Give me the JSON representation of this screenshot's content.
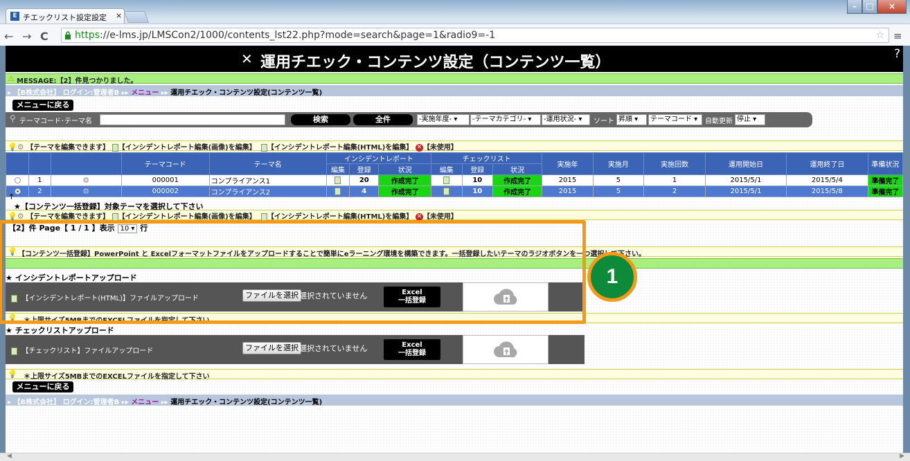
{
  "browser": {
    "tab_title": "チエックリスト設定設定",
    "tab_close": "×",
    "favicon_letter": "E",
    "url_scheme": "https",
    "url_rest": "://e-lms.jp/LMSCon2/1000/contents_lst22.php?mode=search&page=1&radio9=-1"
  },
  "page": {
    "title": "運用チエック・コンテンツ設定（コンテンツ一覧）",
    "message": "MESSAGE:【2】件見つかりました。",
    "breadcrumb_company": "【B株式会社】",
    "breadcrumb_login": "ログイン:管理者B",
    "breadcrumb_menu": "メニュー",
    "breadcrumb_current": "運用チエック・コンテンツ設定(コンテンツ一覧)",
    "back_menu": "メニューに戻る"
  },
  "search": {
    "label": "テーマコード･テーマ名",
    "search_btn": "検索",
    "all_btn": "全件",
    "year_select": "-実施年度-",
    "category_select": "-テーマカテゴリ-",
    "status_select": "-運用状況-",
    "sort_label": "ソート",
    "order_select": "昇順",
    "sortkey_select": "テーマコード",
    "auto_update_label": "自動更新",
    "auto_update_select": "停止"
  },
  "legend": {
    "editable": "【テーマを編集できます】",
    "incident_img": "【インシデントレポート編集(画像)を編集】",
    "incident_html": "【インシデントレポート編集(HTML)を編集】",
    "unused": "【未使用】"
  },
  "table": {
    "headers": {
      "theme_code": "テーマコード",
      "theme_name": "テーマ名",
      "incident_report": "インシデントレポート",
      "checklist": "チェックリスト",
      "edit": "編集",
      "register": "登録",
      "status": "状況",
      "year": "実施年",
      "month": "実施月",
      "times": "実施回数",
      "start_date": "運用開始日",
      "end_date": "運用終了日",
      "prep": "準備状況"
    },
    "rows": [
      {
        "no": "1",
        "code": "000001",
        "name": "コンプライアンス1",
        "ir_count": "20",
        "ir_status": "作成完了",
        "cl_count": "10",
        "cl_status": "作成完了",
        "year": "2015",
        "month": "5",
        "times": "1",
        "start": "2015/5/1",
        "end": "2015/5/4",
        "prep": "準備完了"
      },
      {
        "no": "2",
        "code": "000002",
        "name": "コンプライアンス2",
        "ir_count": "4",
        "ir_status": "作成完了",
        "cl_count": "10",
        "cl_status": "作成完了",
        "year": "2015",
        "month": "5",
        "times": "2",
        "start": "2015/5/1",
        "end": "2015/5/8",
        "prep": "準備完了"
      }
    ]
  },
  "bulk": {
    "select_hint": "★【コンテンツ一括登録】対象テーマを選択して下さい",
    "count": "【2】件",
    "page": "Page【 1 / 1 】表示",
    "per_page": "10",
    "row_unit": "行",
    "info": "【コンテンツ一括登録】PowerPoint と Excelフォーマットファイルをアップロードすることで簡単にeラーニング環境を構築できます。一括登録したいテーマのラジオボタンを一つ選択して下さい。"
  },
  "upload": {
    "incident_section": "★ インシデントレポートアップロード",
    "incident_label": "【インシデントレポート(HTML)】ファイルアップロード",
    "choose_file": "ファイルを選択",
    "no_file": "選択されていません",
    "excel_btn_line1": "Excel",
    "excel_btn_line2": "一括登録",
    "size_note": "＊上限サイズ5MBまでのEXCELファイルを指定して下さい",
    "checklist_section": "★ チェックリストアップロード",
    "checklist_label": "【チェックリスト】ファイルアップロード"
  },
  "badge": "1",
  "colors": {
    "accent_orange": "#f49a16",
    "badge_green": "#0d8a3a",
    "status_green": "#19d613",
    "header_blue": "#3b64b6"
  }
}
